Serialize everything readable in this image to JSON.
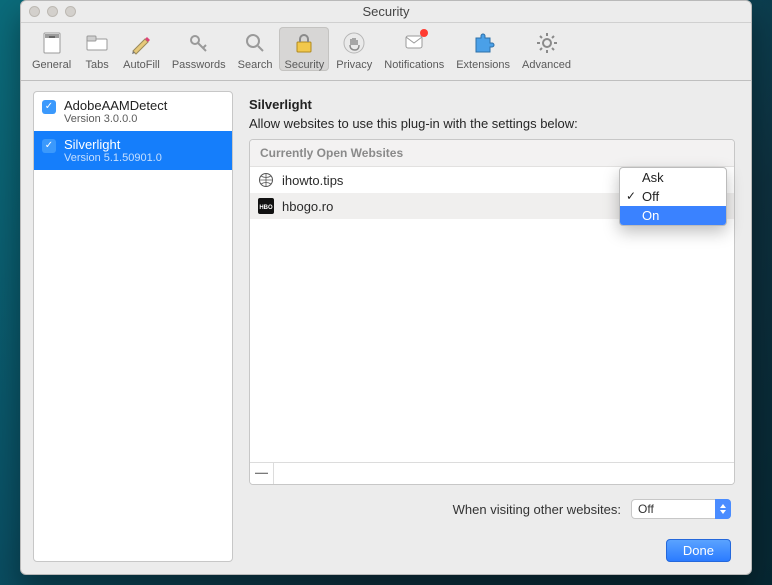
{
  "window_title": "Security",
  "toolbar": [
    {
      "id": "general",
      "label": "General"
    },
    {
      "id": "tabs",
      "label": "Tabs"
    },
    {
      "id": "autofill",
      "label": "AutoFill"
    },
    {
      "id": "passwords",
      "label": "Passwords"
    },
    {
      "id": "search",
      "label": "Search"
    },
    {
      "id": "security",
      "label": "Security",
      "active": true
    },
    {
      "id": "privacy",
      "label": "Privacy"
    },
    {
      "id": "notifications",
      "label": "Notifications",
      "badge": true
    },
    {
      "id": "extensions",
      "label": "Extensions"
    },
    {
      "id": "advanced",
      "label": "Advanced"
    }
  ],
  "plugins": [
    {
      "name": "AdobeAAMDetect",
      "version": "Version 3.0.0.0",
      "checked": true,
      "selected": false
    },
    {
      "name": "Silverlight",
      "version": "Version 5.1.50901.0",
      "checked": true,
      "selected": true
    }
  ],
  "detail": {
    "title": "Silverlight",
    "hint": "Allow websites to use this plug-in with the settings below:",
    "sites_header": "Currently Open Websites",
    "sites": [
      {
        "icon": "globe",
        "name": "ihowto.tips",
        "value": "Off"
      },
      {
        "icon": "hbo",
        "name": "hbogo.ro",
        "value": "Off"
      }
    ],
    "remove_glyph": "—",
    "other_label": "When visiting other websites:",
    "other_value": "Off",
    "done_label": "Done"
  },
  "dropdown": {
    "options": [
      "Ask",
      "Off",
      "On"
    ],
    "checked": "Off",
    "highlight": "On"
  }
}
